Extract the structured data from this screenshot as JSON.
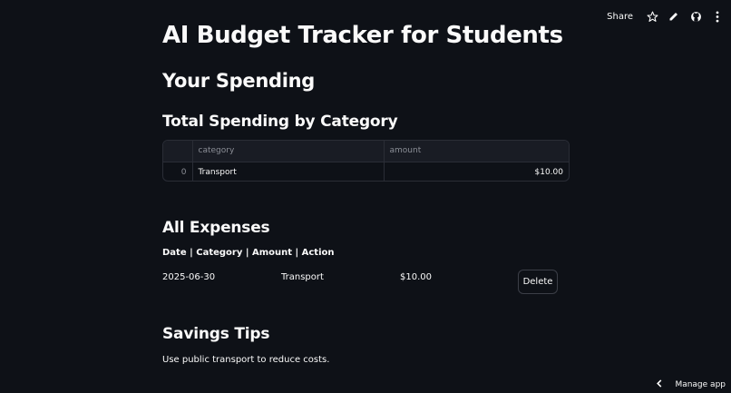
{
  "toolbar": {
    "share_label": "Share",
    "icons": [
      "star-icon",
      "pencil-icon",
      "github-icon",
      "more-vertical-icon"
    ]
  },
  "page": {
    "title": "AI Budget Tracker for Students",
    "spending_heading": "Your Spending",
    "total_heading": "Total Spending by Category",
    "expenses_heading": "All Expenses",
    "expenses_columns": "Date | Category | Amount | Action",
    "tips_heading": "Savings Tips",
    "tip_text": "Use public transport to reduce costs."
  },
  "category_table": {
    "columns": [
      "category",
      "amount"
    ],
    "rows": [
      {
        "index": "0",
        "category": "Transport",
        "amount": "$10.00"
      }
    ]
  },
  "expenses": [
    {
      "date": "2025-06-30",
      "category": "Transport",
      "amount": "$10.00",
      "action": "Delete"
    }
  ],
  "footer": {
    "manage_label": "Manage app"
  },
  "colors": {
    "background": "#0e1117",
    "text": "#fafafa",
    "muted": "#8b8e96",
    "border": "#2a2d36"
  }
}
